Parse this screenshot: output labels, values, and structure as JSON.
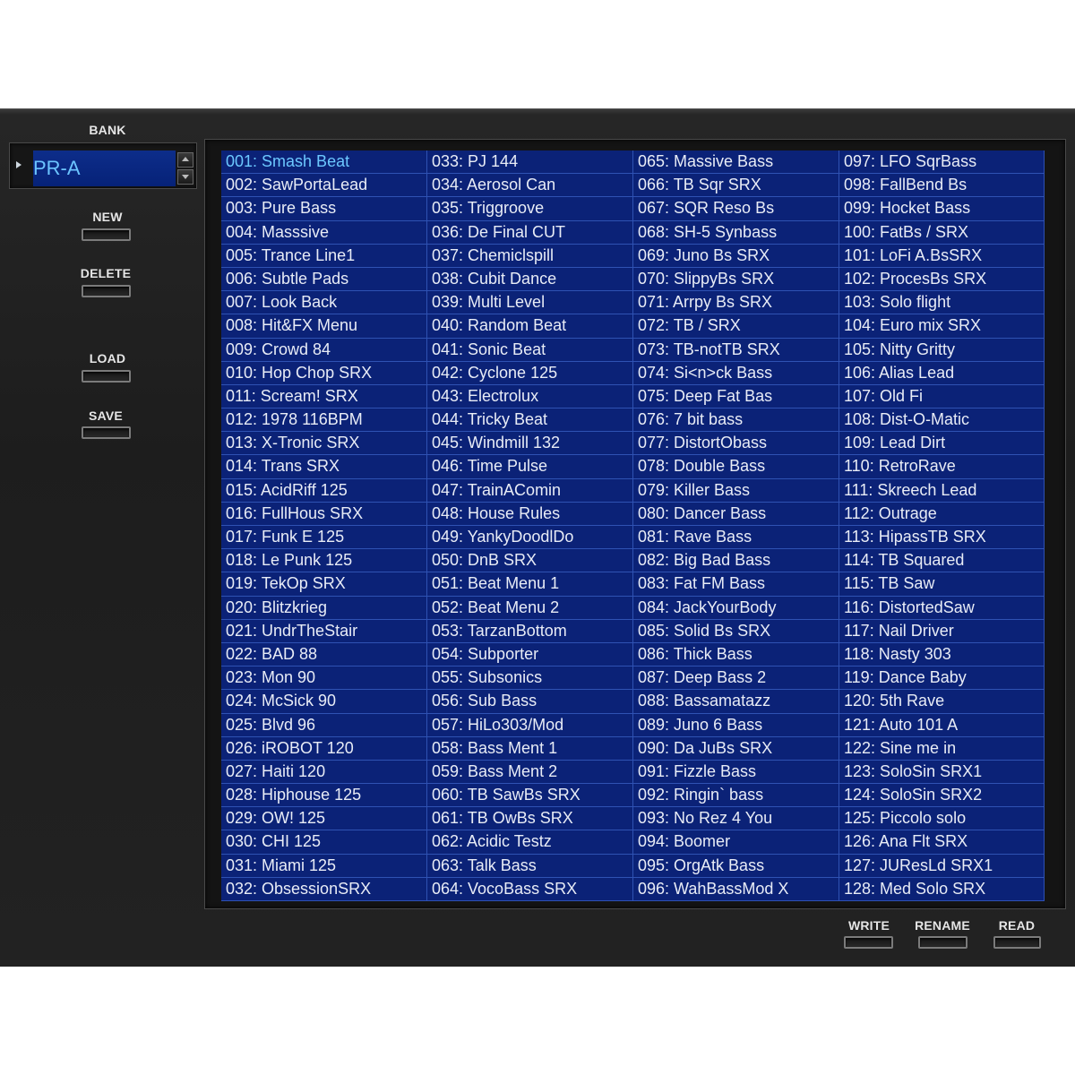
{
  "sidebar": {
    "bank_label": "BANK",
    "bank_value": "PR-A",
    "new_label": "NEW",
    "delete_label": "DELETE",
    "load_label": "LOAD",
    "save_label": "SAVE"
  },
  "footer": {
    "write_label": "WRITE",
    "rename_label": "RENAME",
    "read_label": "READ"
  },
  "colors": {
    "list_bg": "#0b2277",
    "selected_text": "#6cc8ff"
  },
  "patches": [
    "001: Smash Beat",
    "002: SawPortaLead",
    "003: Pure Bass",
    "004: Masssive",
    "005: Trance Line1",
    "006: Subtle Pads",
    "007: Look Back",
    "008: Hit&FX Menu",
    "009: Crowd 84",
    "010: Hop Chop SRX",
    "011: Scream! SRX",
    "012: 1978 116BPM",
    "013: X-Tronic SRX",
    "014: Trans SRX",
    "015: AcidRiff 125",
    "016: FullHous SRX",
    "017: Funk E 125",
    "018: Le Punk 125",
    "019: TekOp SRX",
    "020: Blitzkrieg",
    "021: UndrTheStair",
    "022: BAD 88",
    "023: Mon 90",
    "024: McSick 90",
    "025: Blvd 96",
    "026: iROBOT 120",
    "027: Haiti 120",
    "028: Hiphouse 125",
    "029: OW! 125",
    "030: CHI 125",
    "031: Miami 125",
    "032: ObsessionSRX",
    "033: PJ 144",
    "034: Aerosol Can",
    "035: Triggroove",
    "036: De Final CUT",
    "037: Chemiclspill",
    "038: Cubit Dance",
    "039: Multi Level",
    "040: Random Beat",
    "041: Sonic Beat",
    "042: Cyclone 125",
    "043: Electrolux",
    "044: Tricky Beat",
    "045: Windmill 132",
    "046: Time Pulse",
    "047: TrainAComin",
    "048: House Rules",
    "049: YankyDoodlDo",
    "050: DnB SRX",
    "051: Beat Menu 1",
    "052: Beat Menu 2",
    "053: TarzanBottom",
    "054: Subporter",
    "055: Subsonics",
    "056: Sub Bass",
    "057: HiLo303/Mod",
    "058: Bass Ment 1",
    "059: Bass Ment 2",
    "060: TB SawBs SRX",
    "061: TB OwBs SRX",
    "062: Acidic Testz",
    "063: Talk Bass",
    "064: VocoBass SRX",
    "065: Massive Bass",
    "066: TB Sqr SRX",
    "067: SQR Reso Bs",
    "068: SH-5 Synbass",
    "069: Juno Bs SRX",
    "070: SlippyBs SRX",
    "071: Arrpy Bs SRX",
    "072: TB / SRX",
    "073: TB-notTB SRX",
    "074: Si<n>ck Bass",
    "075: Deep Fat Bas",
    "076: 7 bit bass",
    "077: DistortObass",
    "078: Double Bass",
    "079: Killer Bass",
    "080: Dancer Bass",
    "081: Rave Bass",
    "082: Big Bad Bass",
    "083: Fat FM Bass",
    "084: JackYourBody",
    "085: Solid Bs SRX",
    "086: Thick Bass",
    "087: Deep Bass 2",
    "088: Bassamatazz",
    "089: Juno 6 Bass",
    "090: Da JuBs SRX",
    "091: Fizzle Bass",
    "092: Ringin` bass",
    "093: No Rez 4 You",
    "094: Boomer",
    "095: OrgAtk Bass",
    "096: WahBassMod X",
    "097: LFO SqrBass",
    "098: FallBend Bs",
    "099: Hocket Bass",
    "100: FatBs / SRX",
    "101: LoFi A.BsSRX",
    "102: ProcesBs SRX",
    "103: Solo flight",
    "104: Euro mix SRX",
    "105: Nitty Gritty",
    "106: Alias Lead",
    "107: Old Fi",
    "108: Dist-O-Matic",
    "109: Lead Dirt",
    "110: RetroRave",
    "111: Skreech Lead",
    "112: Outrage",
    "113: HipassTB SRX",
    "114: TB Squared",
    "115: TB Saw",
    "116: DistortedSaw",
    "117: Nail Driver",
    "118: Nasty 303",
    "119: Dance Baby",
    "120: 5th Rave",
    "121: Auto 101 A",
    "122: Sine me in",
    "123: SoloSin SRX1",
    "124: SoloSin SRX2",
    "125: Piccolo solo",
    "126: Ana Flt SRX",
    "127: JUResLd SRX1",
    "128: Med Solo SRX"
  ],
  "selected_index": 0
}
